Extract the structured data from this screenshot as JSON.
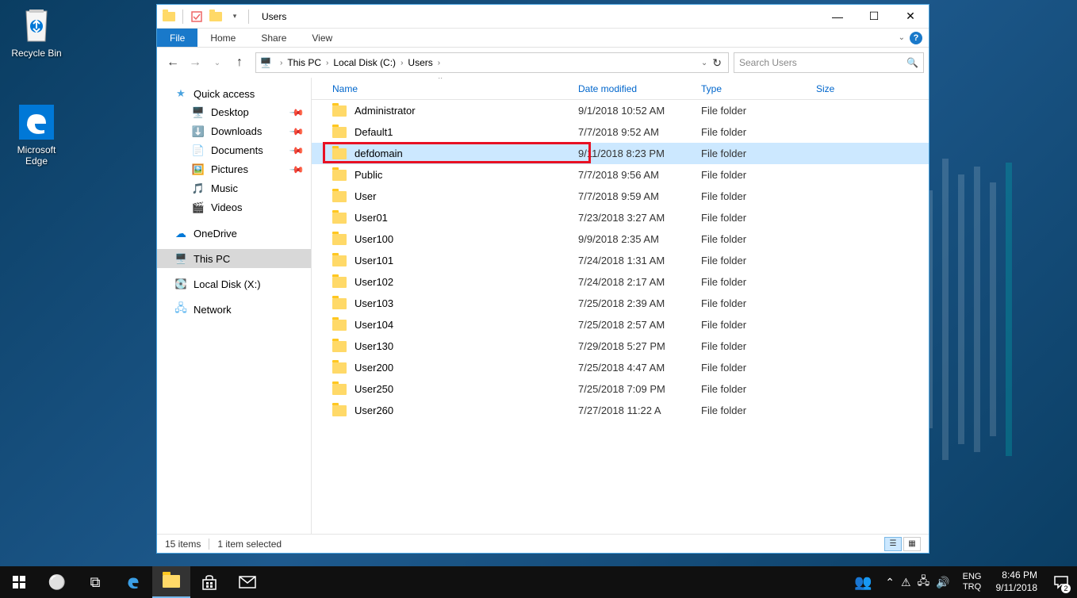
{
  "desktop": {
    "recycle_bin": "Recycle Bin",
    "edge": "Microsoft Edge"
  },
  "window": {
    "title": "Users",
    "ribbon": {
      "file": "File",
      "home": "Home",
      "share": "Share",
      "view": "View"
    },
    "breadcrumb": {
      "seg0": "This PC",
      "seg1": "Local Disk (C:)",
      "seg2": "Users"
    },
    "search_placeholder": "Search Users",
    "navpane": {
      "quick_access": "Quick access",
      "desktop": "Desktop",
      "downloads": "Downloads",
      "documents": "Documents",
      "pictures": "Pictures",
      "music": "Music",
      "videos": "Videos",
      "onedrive": "OneDrive",
      "this_pc": "This PC",
      "local_disk_x": "Local Disk (X:)",
      "network": "Network"
    },
    "columns": {
      "name": "Name",
      "date": "Date modified",
      "type": "Type",
      "size": "Size"
    },
    "rows": [
      {
        "name": "Administrator",
        "date": "9/1/2018 10:52 AM",
        "type": "File folder",
        "selected": false,
        "highlighted": false
      },
      {
        "name": "Default1",
        "date": "7/7/2018 9:52 AM",
        "type": "File folder",
        "selected": false,
        "highlighted": false
      },
      {
        "name": "defdomain",
        "date": "9/11/2018 8:23 PM",
        "type": "File folder",
        "selected": true,
        "highlighted": true
      },
      {
        "name": "Public",
        "date": "7/7/2018 9:56 AM",
        "type": "File folder",
        "selected": false,
        "highlighted": false
      },
      {
        "name": "User",
        "date": "7/7/2018 9:59 AM",
        "type": "File folder",
        "selected": false,
        "highlighted": false
      },
      {
        "name": "User01",
        "date": "7/23/2018 3:27 AM",
        "type": "File folder",
        "selected": false,
        "highlighted": false
      },
      {
        "name": "User100",
        "date": "9/9/2018 2:35 AM",
        "type": "File folder",
        "selected": false,
        "highlighted": false
      },
      {
        "name": "User101",
        "date": "7/24/2018 1:31 AM",
        "type": "File folder",
        "selected": false,
        "highlighted": false
      },
      {
        "name": "User102",
        "date": "7/24/2018 2:17 AM",
        "type": "File folder",
        "selected": false,
        "highlighted": false
      },
      {
        "name": "User103",
        "date": "7/25/2018 2:39 AM",
        "type": "File folder",
        "selected": false,
        "highlighted": false
      },
      {
        "name": "User104",
        "date": "7/25/2018 2:57 AM",
        "type": "File folder",
        "selected": false,
        "highlighted": false
      },
      {
        "name": "User130",
        "date": "7/29/2018 5:27 PM",
        "type": "File folder",
        "selected": false,
        "highlighted": false
      },
      {
        "name": "User200",
        "date": "7/25/2018 4:47 AM",
        "type": "File folder",
        "selected": false,
        "highlighted": false
      },
      {
        "name": "User250",
        "date": "7/25/2018 7:09 PM",
        "type": "File folder",
        "selected": false,
        "highlighted": false
      },
      {
        "name": "User260",
        "date": "7/27/2018 11:22 A",
        "type": "File folder",
        "selected": false,
        "highlighted": false
      }
    ],
    "status": {
      "items": "15 items",
      "selected": "1 item selected"
    }
  },
  "taskbar": {
    "lang1": "ENG",
    "lang2": "TRQ",
    "time": "8:46 PM",
    "date": "9/11/2018",
    "notif_count": "2"
  }
}
